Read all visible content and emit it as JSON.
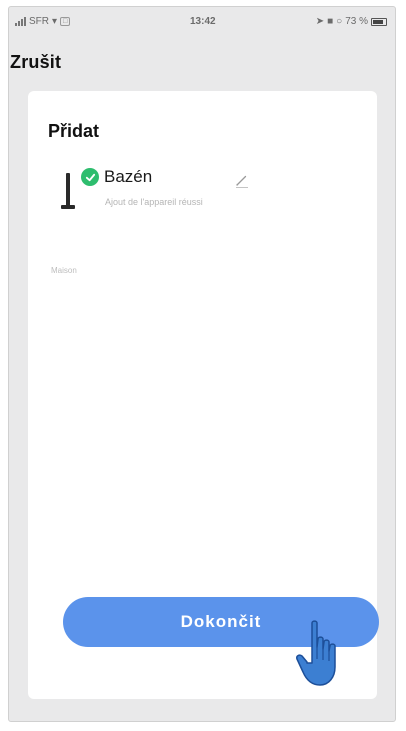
{
  "status_bar": {
    "carrier": "SFR",
    "time": "13:42",
    "battery": "73 %"
  },
  "nav": {
    "cancel_label": "Zrušit"
  },
  "card": {
    "title": "Přidat",
    "device": {
      "name": "Bazén",
      "status_text": "Ajout de l'appareil réussi",
      "icon": "pool-lamp-icon"
    },
    "room_placeholder": "Maison"
  },
  "actions": {
    "done_label": "Dokončit"
  },
  "colors": {
    "accent": "#5b93eb",
    "success": "#2ebd6e",
    "background": "#e9e9ea"
  }
}
